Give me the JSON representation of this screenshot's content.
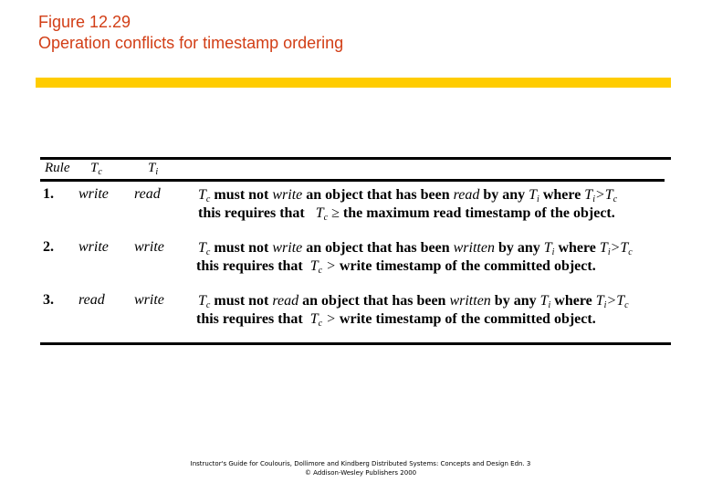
{
  "title": {
    "figure": "Figure 12.29",
    "caption": "Operation conflicts for timestamp ordering"
  },
  "colors": {
    "title": "#d23e16",
    "accent_bar": "#ffcc00",
    "rules": "#000000"
  },
  "table": {
    "headers": {
      "rule": "Rule",
      "tc": "T",
      "tc_sub": "c",
      "ti": "T",
      "ti_sub": "i"
    },
    "rows": [
      {
        "number": "1.",
        "tc_op": "write",
        "ti_op": "read",
        "line1": {
          "subject": "T",
          "subject_sub": "c",
          "must_not": "must not",
          "op": "write",
          "object": "an object that has been",
          "by_op": "read",
          "by_any": "by any",
          "ti": "T",
          "ti_sub": "i",
          "where": "where",
          "cond_left": "T",
          "cond_left_sub": "i",
          "cond_op": ">",
          "cond_right": "T",
          "cond_right_sub": "c"
        },
        "line2": {
          "prefix": "this requires that",
          "subject": "T",
          "subject_sub": "c",
          "relation": "≥",
          "rest": "the maximum read timestamp of the object."
        }
      },
      {
        "number": "2.",
        "tc_op": "write",
        "ti_op": "write",
        "line1": {
          "subject": "T",
          "subject_sub": "c",
          "must_not": "must not",
          "op": "write",
          "object": "an object that has been",
          "by_op": "written",
          "by_any": "by any",
          "ti": "T",
          "ti_sub": "i",
          "where": "where",
          "cond_left": "T",
          "cond_left_sub": "i",
          "cond_op": ">",
          "cond_right": "T",
          "cond_right_sub": "c"
        },
        "line2": {
          "prefix": "this requires that",
          "subject": "T",
          "subject_sub": "c",
          "relation": ">",
          "rest": "write timestamp of the committed object."
        }
      },
      {
        "number": "3.",
        "tc_op": "read",
        "ti_op": "write",
        "line1": {
          "subject": "T",
          "subject_sub": "c",
          "must_not": "must not",
          "op": "read",
          "object": "an object that has been",
          "by_op": "written",
          "by_any": "by any",
          "ti": "T",
          "ti_sub": "i",
          "where": "where",
          "cond_left": "T",
          "cond_left_sub": "i",
          "cond_op": ">",
          "cond_right": "T",
          "cond_right_sub": "c"
        },
        "line2": {
          "prefix": "this requires that",
          "subject": "T",
          "subject_sub": "c",
          "relation": ">",
          "rest": "write timestamp of the committed object."
        }
      }
    ]
  },
  "footer": {
    "line1": "Instructor's Guide for Coulouris, Dollimore and Kindberg Distributed Systems: Concepts and Design Edn. 3",
    "line2": "© Addison-Wesley Publishers 2000"
  }
}
